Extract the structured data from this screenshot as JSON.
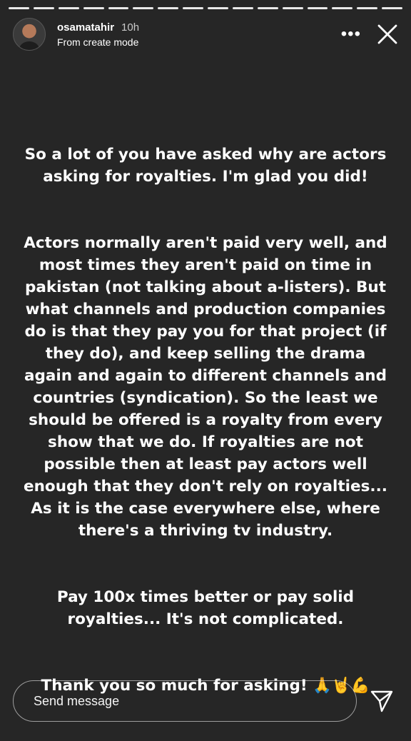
{
  "progress": {
    "segments": 16,
    "current": 16
  },
  "header": {
    "username": "osamatahir",
    "time": "10h",
    "subtitle": "From create mode"
  },
  "story": {
    "paragraphs": [
      "So a lot of you have asked why are actors asking for royalties. I'm glad you did!",
      "Actors normally aren't paid very well, and most times they aren't paid on time in pakistan (not talking about a-listers). But what channels and production companies do is that they pay you for that project (if they do), and keep selling the drama again and again to different channels and countries (syndication). So the least we should be offered is a royalty from every show that we do. If royalties are not possible then at least pay actors well enough that they don't rely on royalties... As it is the case everywhere else, where there's a thriving tv industry.",
      "Pay 100x times better or pay solid royalties... It's not complicated.",
      "Thank you so much for asking! 🙏🤘💪"
    ]
  },
  "footer": {
    "message_placeholder": "Send message"
  },
  "icons": {
    "more": "more-options-icon",
    "close": "close-icon",
    "send": "send-icon"
  }
}
